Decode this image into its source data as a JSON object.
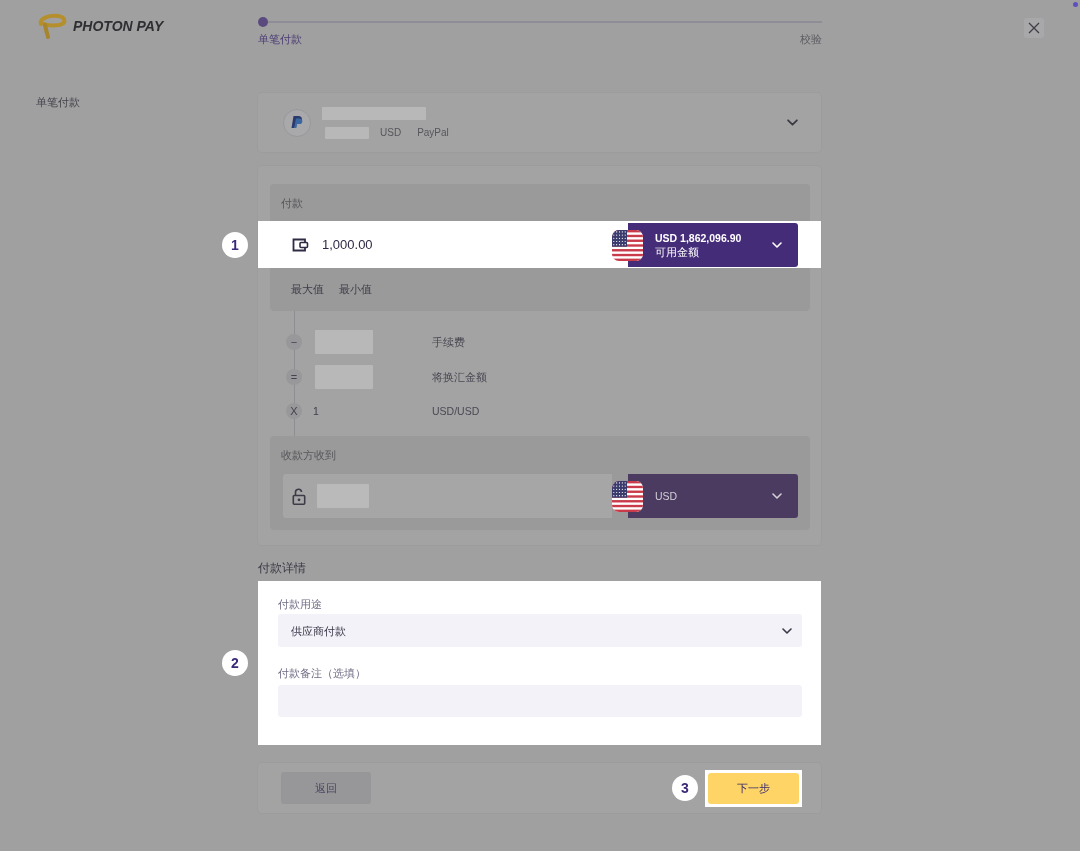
{
  "header": {
    "logo": "PHOTON PAY",
    "steps": [
      {
        "label": "单笔付款",
        "selected": true
      },
      {
        "label": "校验",
        "selected": false
      }
    ]
  },
  "sidebar": {
    "title": "单笔付款"
  },
  "payee": {
    "redacted": true,
    "currency": "USD",
    "method": "PayPal"
  },
  "payment": {
    "label": "付款",
    "highlighted": true,
    "callout": "1",
    "amount": "1,000.00",
    "balance": "USD 1,862,096.90",
    "balance_label": "可用金额",
    "shortcuts": [
      "最大值",
      "最小值"
    ]
  },
  "breakdown": [
    {
      "operator": "−",
      "redacted": true,
      "label": "手续费"
    },
    {
      "operator": "=",
      "redacted": true,
      "label": "将换汇金额"
    },
    {
      "operator": "X",
      "value": "1",
      "label": "USD/USD"
    }
  ],
  "receive": {
    "label": "收款方收到",
    "highlighted": false,
    "redacted": true,
    "currency": "USD"
  },
  "details": {
    "title": "付款详情",
    "highlighted": true,
    "callout": "2",
    "purpose": {
      "label": "付款用途",
      "value": "供应商付款"
    },
    "note": {
      "label": "付款备注（选填）"
    }
  },
  "actions": {
    "back": {
      "label": "返回"
    },
    "next": {
      "label": "下一步",
      "highlighted": true,
      "callout": "3"
    }
  }
}
